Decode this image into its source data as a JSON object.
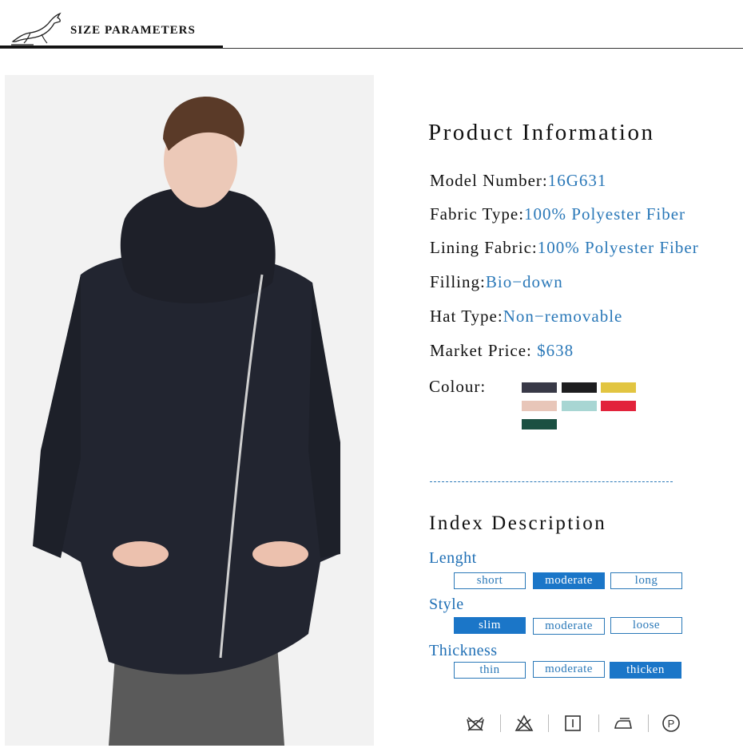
{
  "header": {
    "title": "SIZE PARAMETERS"
  },
  "product": {
    "title": "Product Information",
    "model_label": "Model Number:",
    "model_value": "16G631",
    "fabric_label": "Fabric Type:",
    "fabric_value": "100% Polyester Fiber",
    "lining_label": "Lining Fabric:",
    "lining_value": "100% Polyester Fiber",
    "filling_label": "Filling:",
    "filling_value": "Bio−down",
    "hat_label": "Hat Type:",
    "hat_value": "Non−removable",
    "price_label": "Market Price: ",
    "price_value": "$638",
    "colour_label": "Colour:",
    "colours": [
      "#383947",
      "#1d1d1f",
      "#e2c541",
      "#e8c6b9",
      "#a8d6d3",
      "#e2233b",
      "#1b5042"
    ]
  },
  "index": {
    "title": "Index Description",
    "length": {
      "label": "Lenght",
      "options": [
        "short",
        "moderate",
        "long"
      ],
      "selected": "moderate"
    },
    "style": {
      "label": "Style",
      "options": [
        "slim",
        "moderate",
        "loose"
      ],
      "selected": "slim"
    },
    "thickness": {
      "label": "Thickness",
      "options": [
        "thin",
        "moderate",
        "thicken"
      ],
      "selected": "thicken"
    }
  },
  "care_icons": [
    "do-not-wash-icon",
    "do-not-bleach-icon",
    "tumble-dry-icon",
    "iron-icon",
    "dry-clean-icon"
  ],
  "accent_color": "#1b76c8"
}
